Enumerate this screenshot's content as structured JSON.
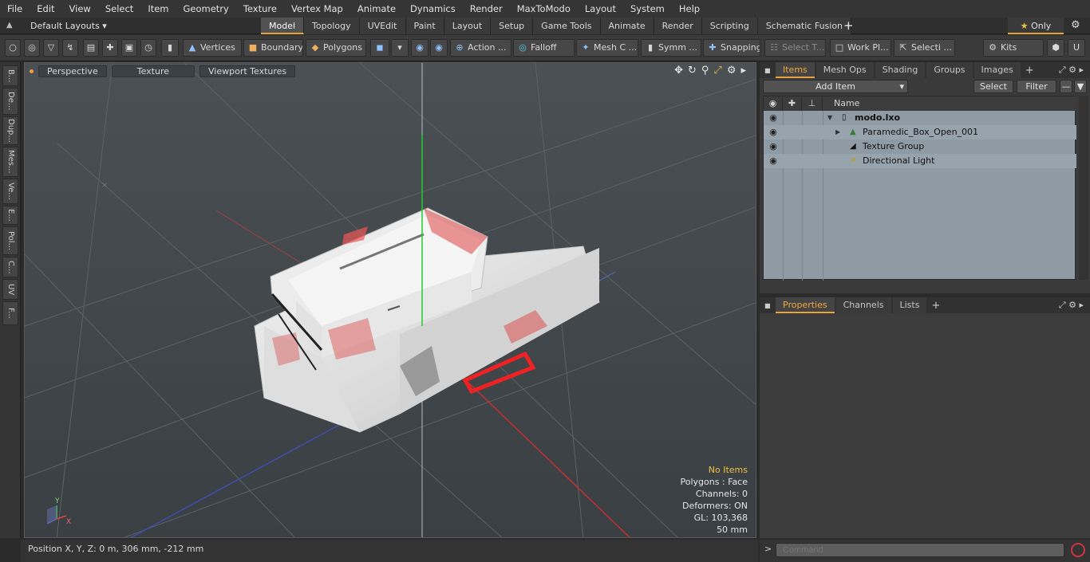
{
  "menu": [
    "File",
    "Edit",
    "View",
    "Select",
    "Item",
    "Geometry",
    "Texture",
    "Vertex Map",
    "Animate",
    "Dynamics",
    "Render",
    "MaxToModo",
    "Layout",
    "System",
    "Help"
  ],
  "layout": {
    "default_label": "Default Layouts ▾",
    "tabs": [
      "Model",
      "Topology",
      "UVEdit",
      "Paint",
      "Layout",
      "Setup",
      "Game Tools",
      "Animate",
      "Render",
      "Scripting",
      "Schematic Fusion"
    ],
    "active_tab": "Model",
    "add_tab": "+",
    "only_label": "Only",
    "only_star": "★"
  },
  "toolbar": {
    "vertices": "Vertices",
    "boundary": "Boundary",
    "polygons": "Polygons",
    "action": "Action ...",
    "falloff": "Falloff",
    "mesh_c": "Mesh C ...",
    "symm": "Symm ...",
    "snapping": "Snapping",
    "select_t": "Select T...",
    "work_pl": "Work Pl...",
    "selecti": "Selecti ...",
    "kits": "Kits"
  },
  "left_tabs": [
    "B...",
    "De...",
    "Dup...",
    "Mes...",
    "Ve...",
    "E...",
    "Pol...",
    "C...",
    "UV",
    "F..."
  ],
  "viewport": {
    "perspective": "Perspective",
    "texture": "Texture",
    "viewport_textures": "Viewport Textures",
    "info": {
      "no_items": "No Items",
      "polygons": "Polygons : Face",
      "channels": "Channels: 0",
      "deformers": "Deformers: ON",
      "gl": "GL: 103,368",
      "scale": "50 mm"
    },
    "axis_labels": {
      "x": "X",
      "y": "Y"
    }
  },
  "status": {
    "position": "Position X, Y, Z:   0 m, 306 mm, -212 mm"
  },
  "items_panel": {
    "tabs": [
      "Items",
      "Mesh Ops",
      "Shading",
      "Groups",
      "Images"
    ],
    "active_tab": "Items",
    "add_item": "Add Item",
    "select": "Select",
    "filter": "Filter",
    "name_col": "Name",
    "rows": [
      {
        "label": "modo.lxo",
        "bold": true
      },
      {
        "label": "Paramedic_Box_Open_001",
        "bold": false
      },
      {
        "label": "Texture Group",
        "bold": false
      },
      {
        "label": "Directional Light",
        "bold": false
      }
    ]
  },
  "properties_panel": {
    "tabs": [
      "Properties",
      "Channels",
      "Lists"
    ],
    "active_tab": "Properties"
  },
  "command": {
    "prompt": ">",
    "placeholder": "Command"
  }
}
